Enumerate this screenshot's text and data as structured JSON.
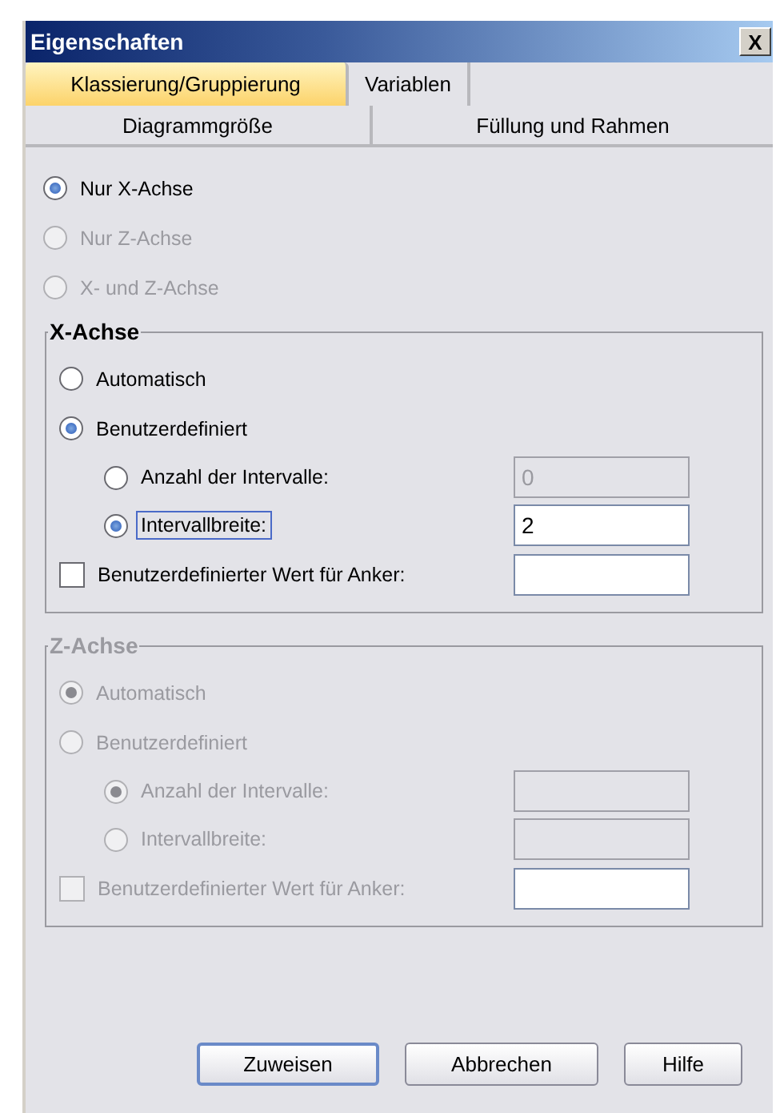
{
  "window": {
    "title": "Eigenschaften",
    "close": "X"
  },
  "tab_rows": [
    {
      "tabs": [
        {
          "label": "Klassierung/Gruppierung",
          "selected": true
        },
        {
          "label": "Variablen",
          "selected": false
        }
      ]
    },
    {
      "tabs": [
        {
          "label": "Diagrammgröße",
          "selected": false
        },
        {
          "label": "Füllung und Rahmen",
          "selected": false
        }
      ]
    }
  ],
  "axis_options": [
    {
      "label": "Nur X-Achse",
      "selected": true,
      "disabled": false
    },
    {
      "label": "Nur Z-Achse",
      "selected": false,
      "disabled": true
    },
    {
      "label": "X- und Z-Achse",
      "selected": false,
      "disabled": true
    }
  ],
  "groups": [
    {
      "title": "X-Achse",
      "disabled": false,
      "items": [
        {
          "kind": "radio",
          "label": "Automatisch",
          "selected": false
        },
        {
          "kind": "radio",
          "label": "Benutzerdefiniert",
          "selected": true,
          "children": [
            {
              "label": "Anzahl der Intervalle:",
              "selected": false,
              "focused": false,
              "field": {
                "value": "0",
                "disabled": true
              }
            },
            {
              "label": "Intervallbreite:",
              "selected": true,
              "focused": true,
              "field": {
                "value": "2",
                "disabled": false
              }
            }
          ]
        },
        {
          "kind": "checkbox",
          "label": "Benutzerdefinierter Wert für Anker:",
          "checked": false,
          "field": {
            "disabled": false
          }
        }
      ]
    },
    {
      "title": "Z-Achse",
      "disabled": true,
      "items": [
        {
          "kind": "radio",
          "label": "Automatisch",
          "selected": true
        },
        {
          "kind": "radio",
          "label": "Benutzerdefiniert",
          "selected": false,
          "children": [
            {
              "label": "Anzahl der Intervalle:",
              "selected": true,
              "focused": false,
              "field": {
                "disabled": true
              }
            },
            {
              "label": "Intervallbreite:",
              "selected": false,
              "focused": false,
              "field": {
                "disabled": true
              }
            }
          ]
        },
        {
          "kind": "checkbox",
          "label": "Benutzerdefinierter Wert für Anker:",
          "checked": false,
          "field": {
            "disabled": false
          }
        }
      ]
    }
  ],
  "buttons": [
    {
      "label": "Zuweisen",
      "default": true
    },
    {
      "label": "Abbrechen",
      "default": false
    },
    {
      "label": "Hilfe",
      "default": false
    }
  ]
}
